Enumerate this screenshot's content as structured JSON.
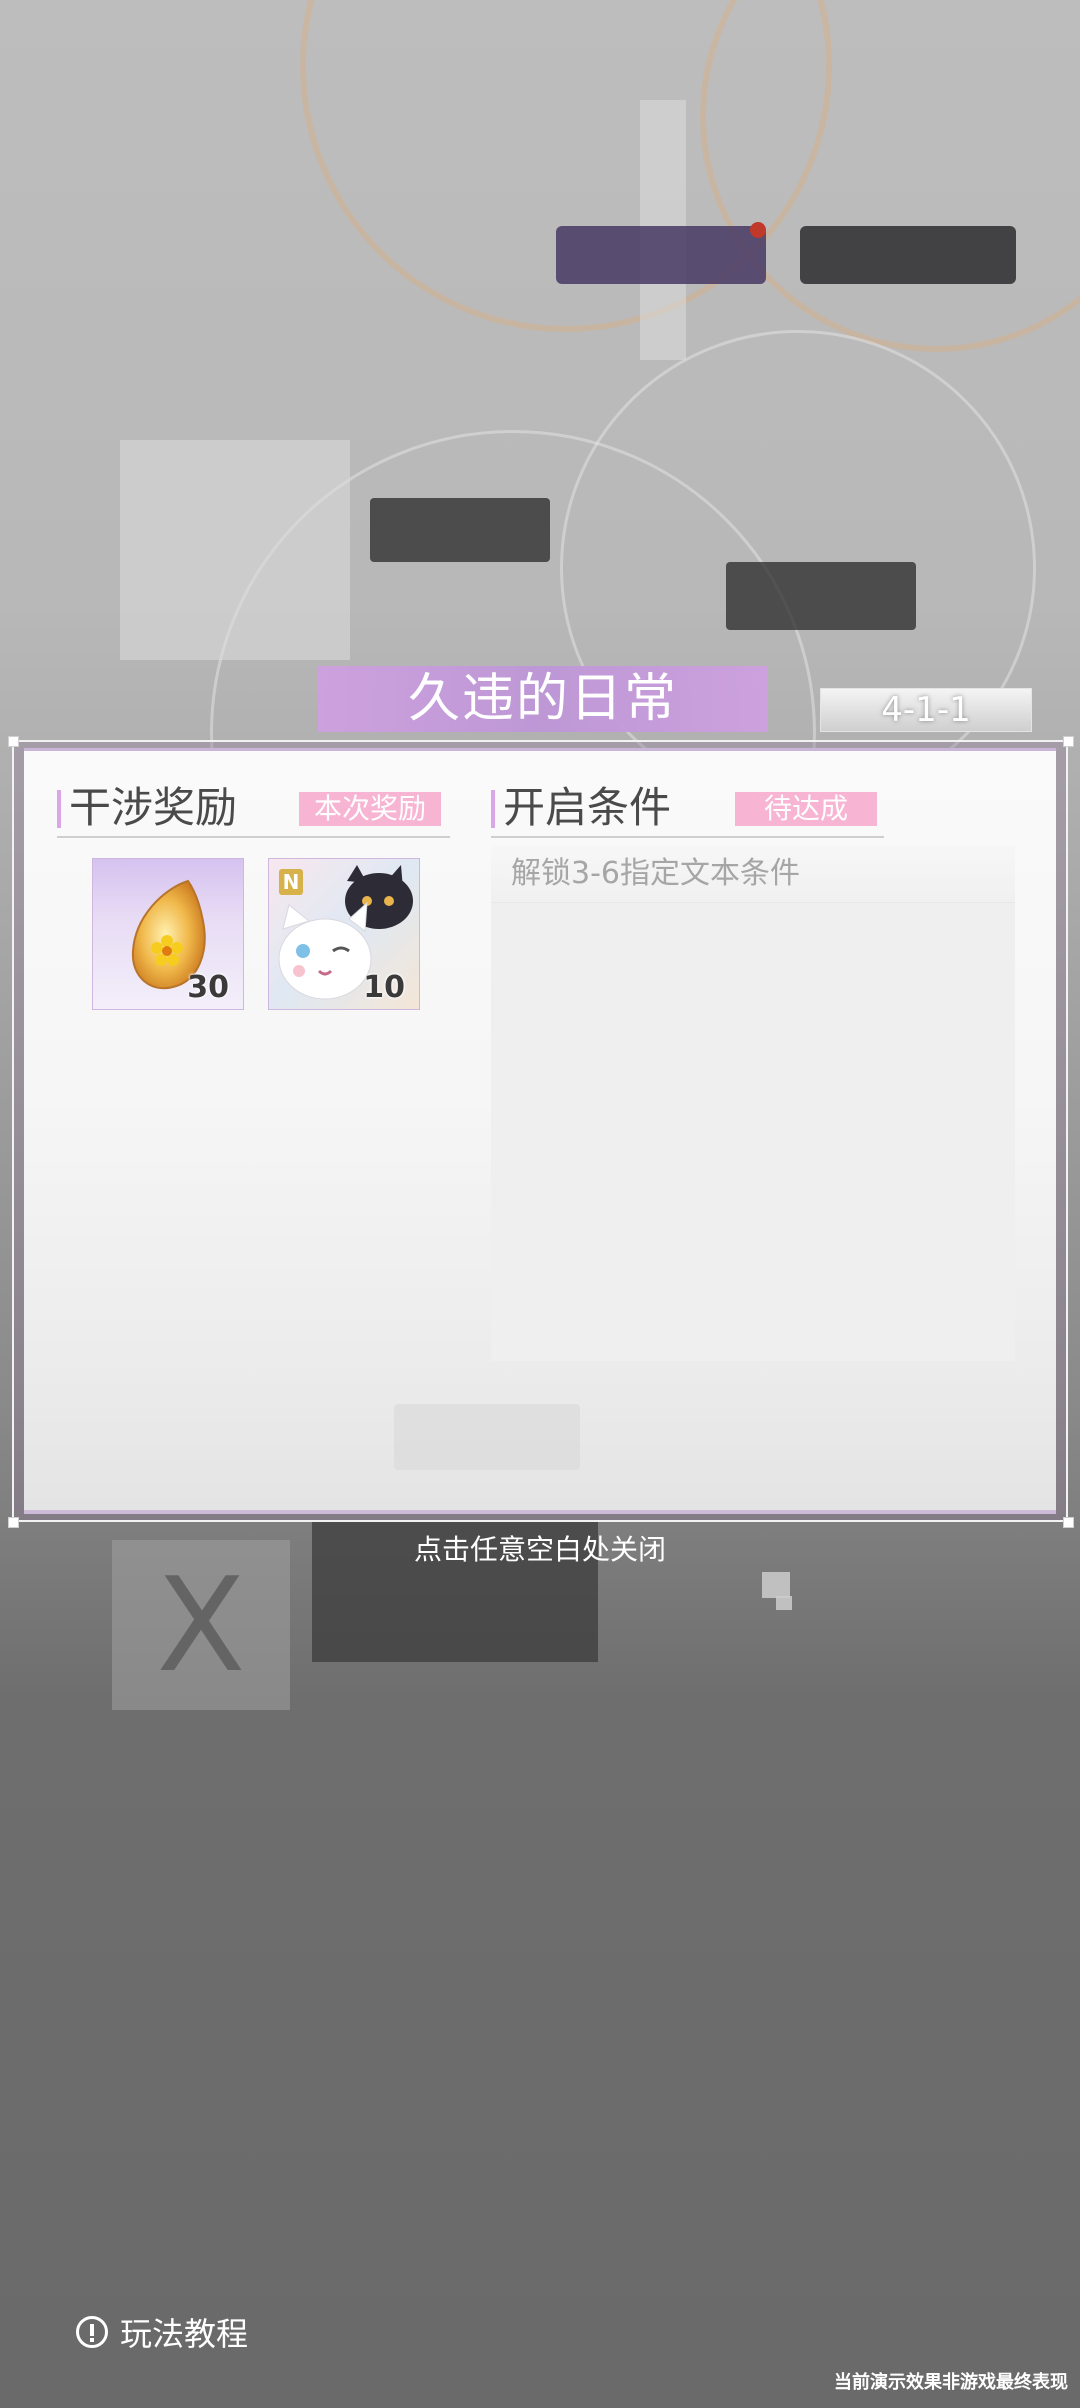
{
  "stage": {
    "title": "久违的日常",
    "code": "4-1-1"
  },
  "rewards_section": {
    "title": "干涉奖励",
    "tag": "本次奖励",
    "items": [
      {
        "icon": "amber-flower-drop-icon",
        "count": "30"
      },
      {
        "icon": "cats-portrait-card-icon",
        "badge": "N",
        "count": "10"
      }
    ]
  },
  "conditions_section": {
    "title": "开启条件",
    "tag": "待达成",
    "items": [
      "解锁3-6指定文本条件"
    ]
  },
  "close_hint": "点击任意空白处关闭",
  "tutorial": {
    "label": "玩法教程",
    "icon": "exclamation-circle-icon"
  },
  "disclaimer": "当前演示效果非游戏最终表现",
  "colors": {
    "accent_purple": "#ce a0e0",
    "tag_pink": "#f7b4d3"
  }
}
